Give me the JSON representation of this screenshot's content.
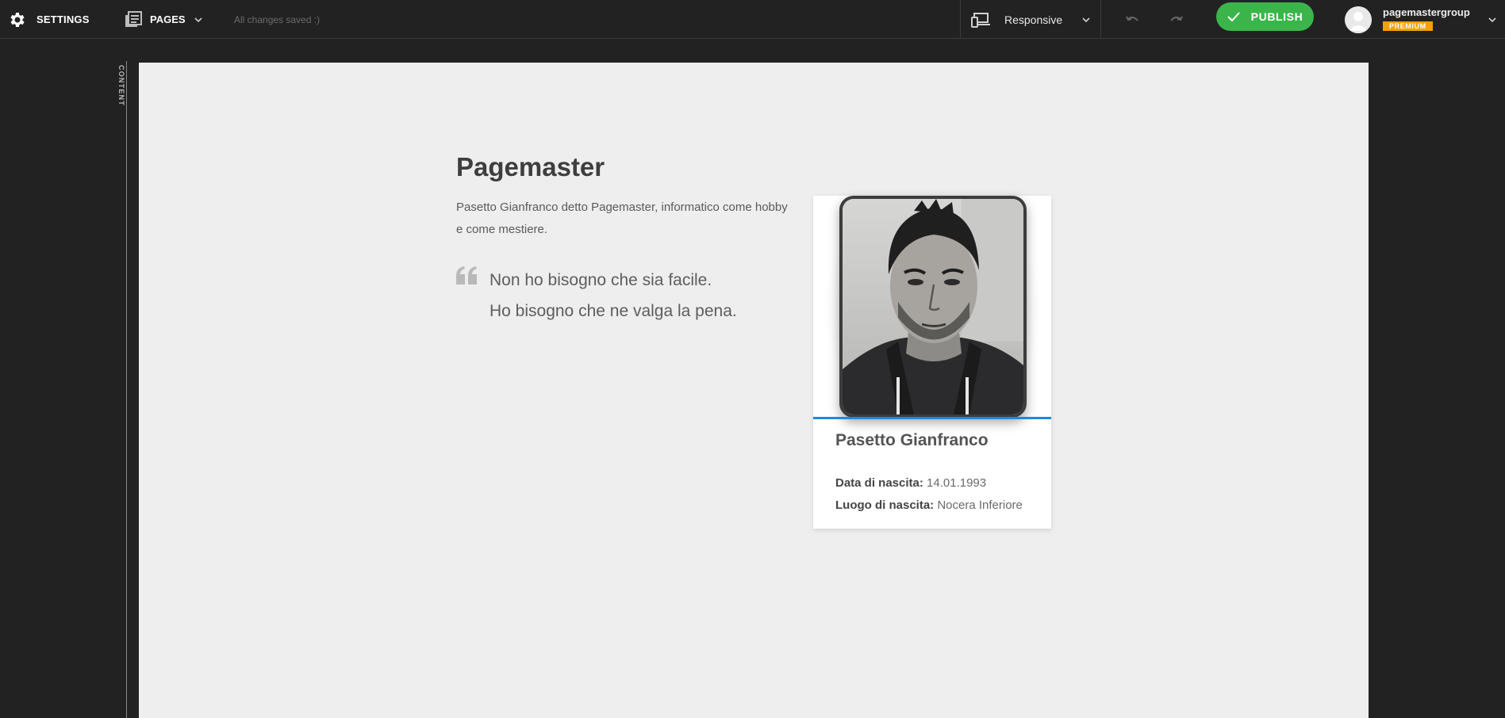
{
  "toolbar": {
    "settings_label": "SETTINGS",
    "pages_label": "PAGES",
    "save_status": "All changes saved :)",
    "device_label": "Responsive",
    "publish_label": "PUBLISH",
    "username": "pagemastergroup",
    "plan_badge": "PREMIUM"
  },
  "sidebar": {
    "tab_label": "CONTENT"
  },
  "content": {
    "title": "Pagemaster",
    "description": "Pasetto Gianfranco detto Pagemaster, informatico come hobby e come mestiere.",
    "quote_line1": "Non ho bisogno che sia facile.",
    "quote_line2": "Ho bisogno che ne valga la pena."
  },
  "profile_card": {
    "name": "Pasetto Gianfranco",
    "birth_date_label": "Data di nascita:",
    "birth_date_value": "14.01.1993",
    "birth_place_label": "Luogo di nascita:",
    "birth_place_value": "Nocera Inferiore"
  },
  "colors": {
    "topbar_bg": "#222222",
    "publish_green": "#3bb54a",
    "premium_orange": "#f5a000",
    "card_accent_blue": "#1e88e5",
    "canvas_bg": "#eeeeee"
  },
  "icons": {
    "settings": "gear-icon",
    "pages": "pages-icon",
    "device": "responsive-devices-icon",
    "undo": "undo-icon",
    "redo": "redo-icon",
    "publish": "check-icon",
    "quote": "quote-icon"
  }
}
